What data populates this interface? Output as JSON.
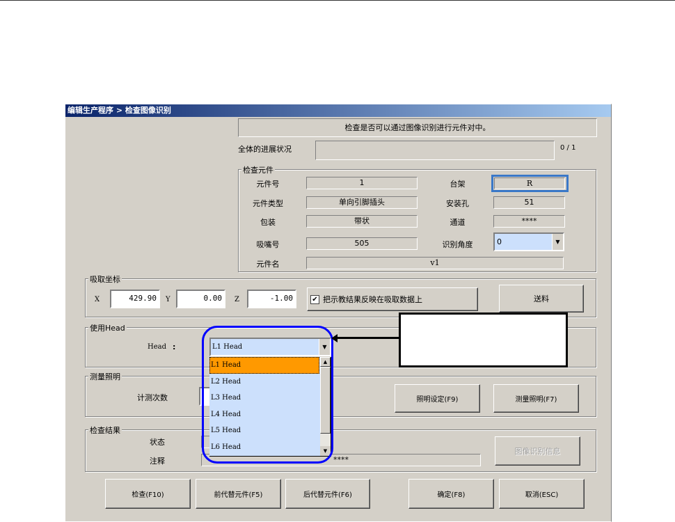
{
  "window": {
    "title": "编辑生产程序 > 检查图像识别"
  },
  "instruction": "检查是否可以通过图像识别进行元件对中。",
  "progress": {
    "label": "全体的进展状况",
    "count": "0 / 1",
    "value": 0
  },
  "inspect_part": {
    "title": "检查元件",
    "left": [
      {
        "label": "元件号",
        "value": "1"
      },
      {
        "label": "元件类型",
        "value": "单向引脚插头"
      },
      {
        "label": "包装",
        "value": "带状"
      },
      {
        "label": "吸嘴号",
        "value": "505"
      }
    ],
    "right": [
      {
        "label": "台架",
        "value": "R"
      },
      {
        "label": "安装孔",
        "value": "51"
      },
      {
        "label": "通道",
        "value": "****"
      },
      {
        "label": "识别角度",
        "value": "0"
      }
    ],
    "name": {
      "label": "元件名",
      "value": "v1"
    }
  },
  "pick_coords": {
    "title": "吸取坐标",
    "x_label": "X",
    "x": "429.90",
    "y_label": "Y",
    "y": "0.00",
    "z_label": "Z",
    "z": "-1.00",
    "checkbox_label": "把示教结果反映在吸取数据上",
    "checked": true,
    "feed_button": "送料"
  },
  "head": {
    "title": "使用Head",
    "label": "Head",
    "colon": ":",
    "selected": "L1 Head",
    "options": [
      "L1 Head",
      "L2 Head",
      "L3 Head",
      "L4 Head",
      "L5 Head",
      "L6 Head"
    ]
  },
  "lighting": {
    "title": "测量照明",
    "count_label": "计测次数",
    "setting_button": "照明设定(F9)",
    "measure_button": "测量照明(F7)"
  },
  "result": {
    "title": "检查结果",
    "status_label": "状态",
    "note_label": "注释",
    "note_value": "****",
    "info_button": "图像识别信息"
  },
  "buttons": {
    "inspect": "检查(F10)",
    "prev": "前代替元件(F5)",
    "next": "后代替元件(F6)",
    "ok": "确定(F8)",
    "cancel": "取消(ESC)"
  },
  "colors": {
    "highlight_border": "#3a78c8",
    "annotation": "#0000ff",
    "selected_item": "#ff9900",
    "list_bg": "#cce0fc"
  }
}
